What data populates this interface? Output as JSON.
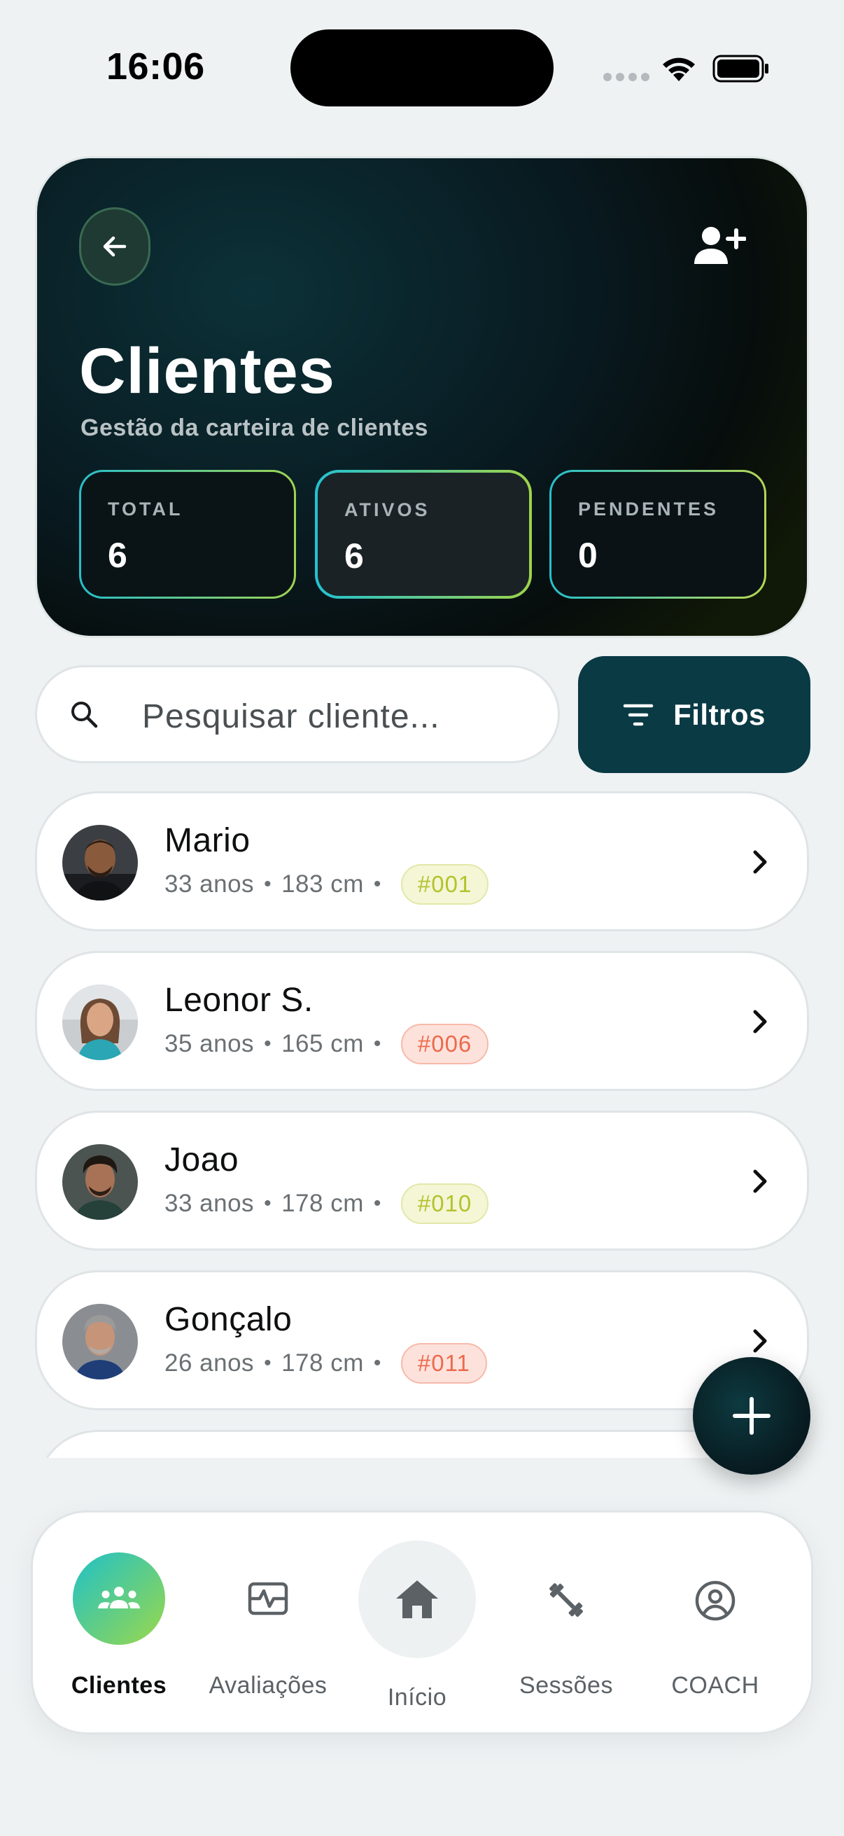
{
  "status_bar": {
    "time": "16:06"
  },
  "header": {
    "title": "Clientes",
    "subtitle": "Gestão da carteira de clientes",
    "stats": [
      {
        "label": "TOTAL",
        "value": "6"
      },
      {
        "label": "ATIVOS",
        "value": "6"
      },
      {
        "label": "PENDENTES",
        "value": "0"
      }
    ]
  },
  "search": {
    "placeholder": "Pesquisar cliente..."
  },
  "filter": {
    "label": "Filtros"
  },
  "clients": [
    {
      "name": "Mario",
      "age": "33 anos",
      "height": "183 cm",
      "id": "#001",
      "badge_color": "yellow"
    },
    {
      "name": "Leonor S.",
      "age": "35 anos",
      "height": "165 cm",
      "id": "#006",
      "badge_color": "red"
    },
    {
      "name": "Joao",
      "age": "33 anos",
      "height": "178 cm",
      "id": "#010",
      "badge_color": "yellow"
    },
    {
      "name": "Gonçalo",
      "age": "26 anos",
      "height": "178 cm",
      "id": "#011",
      "badge_color": "red"
    }
  ],
  "nav": {
    "items": [
      {
        "label": "Clientes",
        "icon": "group-icon",
        "active": true
      },
      {
        "label": "Avaliações",
        "icon": "activity-icon",
        "active": false
      },
      {
        "label": "Início",
        "icon": "home-icon",
        "active": false
      },
      {
        "label": "Sessões",
        "icon": "dumbbell-icon",
        "active": false
      },
      {
        "label": "COACH",
        "icon": "account-circle-icon",
        "active": false
      }
    ]
  },
  "colors": {
    "accent_teal": "#1fc1c8",
    "accent_lime": "#9bd84a",
    "dark_teal": "#0a3a44",
    "badge_yellow_text": "#b4c22c",
    "badge_red_text": "#ec6a4c"
  }
}
